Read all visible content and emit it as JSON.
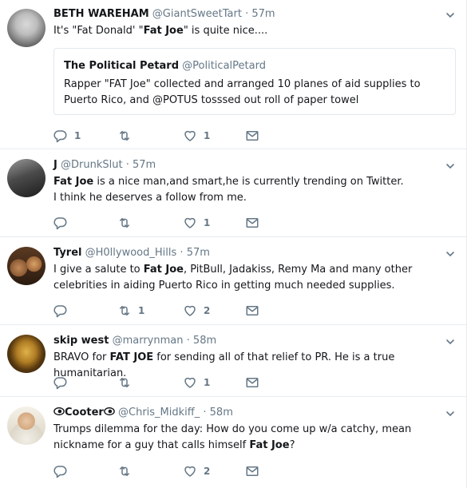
{
  "tweets": [
    {
      "name": "BETH WAREHAM",
      "handle": "@GiantSweetTart",
      "dot": "·",
      "time": "57m",
      "text_parts": [
        "It's \"Fat Donald'  \"",
        "Fat Joe",
        "\" is quite nice...."
      ],
      "quote": {
        "name": "The Political Petard",
        "handle": "@PoliticalPetard",
        "text": "Rapper \"FAT Joe\" collected and arranged 10 planes of aid supplies to Puerto Rico, and @POTUS tosssed out roll of paper towel"
      },
      "reply_count": "1",
      "retweet_count": "",
      "like_count": "1"
    },
    {
      "name": "J",
      "handle": "@DrunkSlut",
      "dot": "·",
      "time": "57m",
      "text_parts": [
        "Fat Joe",
        " is a nice man,and smart,he is currently trending on Twitter."
      ],
      "text_line2": "I think he deserves a follow from me.",
      "reply_count": "",
      "retweet_count": "",
      "like_count": "1"
    },
    {
      "name": "Tyrel",
      "handle": "@H0llywood_Hills",
      "dot": "·",
      "time": "57m",
      "text_parts": [
        "I give a salute to ",
        "Fat Joe",
        ", PitBull, Jadakiss, Remy Ma and many other celebrities in aiding Puerto Rico in getting much needed supplies."
      ],
      "reply_count": "",
      "retweet_count": "1",
      "like_count": "2"
    },
    {
      "name": "skip west",
      "handle": "@marrynman",
      "dot": "·",
      "time": "58m",
      "text_parts": [
        "BRAVO for ",
        "FAT JOE",
        " for sending all of that relief to PR.  He is a true humanitarian."
      ],
      "reply_count": "",
      "retweet_count": "",
      "like_count": "1"
    },
    {
      "name": "Cooter",
      "handle": "@Chris_Midkiff_",
      "dot": "·",
      "time": "58m",
      "text_parts": [
        "Trumps dilemma for the day: How do you come up w/a catchy, mean nickname for a guy that calls himself ",
        "Fat Joe",
        "?"
      ],
      "reply_count": "",
      "retweet_count": "",
      "like_count": "2"
    }
  ],
  "colors": {
    "secondary": "#657786",
    "border": "#e6ecf0",
    "text": "#14171a"
  },
  "icons": {
    "reply": "reply-icon",
    "retweet": "retweet-icon",
    "like": "heart-icon",
    "dm": "envelope-icon",
    "caret": "chevron-down-icon",
    "eye": "eye-emoji-icon"
  }
}
